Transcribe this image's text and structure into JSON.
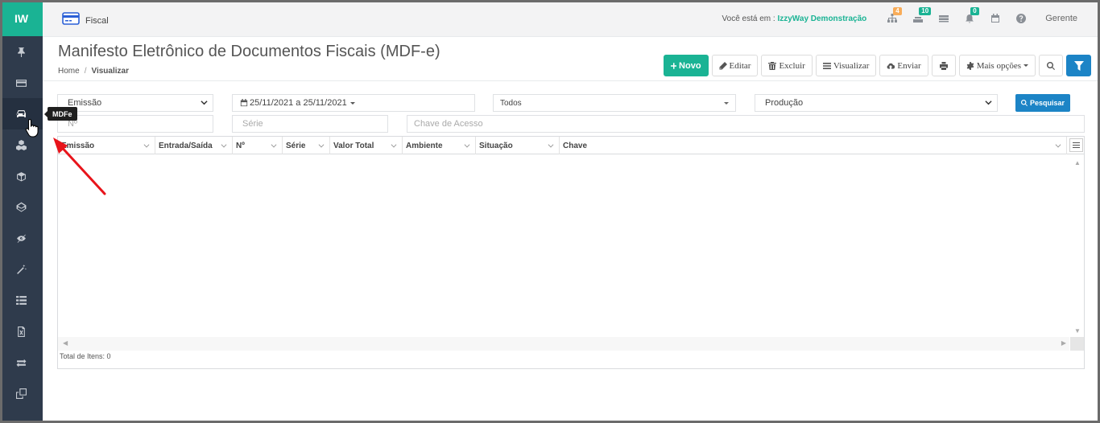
{
  "sidebar": {
    "logo": "IW",
    "items": [
      {
        "icon": "pin-icon"
      },
      {
        "icon": "card-icon"
      },
      {
        "icon": "car-icon",
        "active": true
      },
      {
        "icon": "cubes-icon"
      },
      {
        "icon": "cube-icon"
      },
      {
        "icon": "codepen-icon"
      },
      {
        "icon": "eye-slash-icon"
      },
      {
        "icon": "magic-wand-icon"
      },
      {
        "icon": "list-icon"
      },
      {
        "icon": "file-excel-icon"
      },
      {
        "icon": "exchange-icon"
      },
      {
        "icon": "clone-icon"
      }
    ],
    "tooltip": "MDFe"
  },
  "topbar": {
    "module": "Fiscal",
    "where_label": "Você está em :",
    "company": "IzzyWay Demonstração",
    "badges": {
      "sitemap": "4",
      "users": "10",
      "bell": "0"
    },
    "badge_colors": {
      "sitemap": "#f8ac59",
      "users": "#1ab394",
      "bell": "#1ab394"
    },
    "user": "Gerente"
  },
  "header": {
    "title": "Manifesto Eletrônico de Documentos Fiscais (MDF-e)",
    "breadcrumb": {
      "home": "Home",
      "current": "Visualizar"
    }
  },
  "toolbar": {
    "novo": "Novo",
    "editar": "Editar",
    "excluir": "Excluir",
    "visualizar": "Visualizar",
    "enviar": "Enviar",
    "mais_opcoes": "Mais opções"
  },
  "filters": {
    "date_type": "Emissão",
    "date_range": "25/11/2021 a 25/11/2021",
    "status": "Todos",
    "ambiente": "Produção",
    "search_button": "Pesquisar",
    "numero_placeholder": "Nº",
    "serie_placeholder": "Série",
    "chave_placeholder": "Chave de Acesso"
  },
  "grid": {
    "columns": [
      "Emissão",
      "Entrada/Saída",
      "Nº",
      "Série",
      "Valor Total",
      "Ambiente",
      "Situação",
      "Chave"
    ],
    "rows": [],
    "total": "Total de Itens: 0"
  },
  "colors": {
    "accent": "#1ab394",
    "primary_blue": "#1c84c6",
    "sidebar": "#2f3b4c",
    "annotation_arrow": "#e8141b"
  }
}
